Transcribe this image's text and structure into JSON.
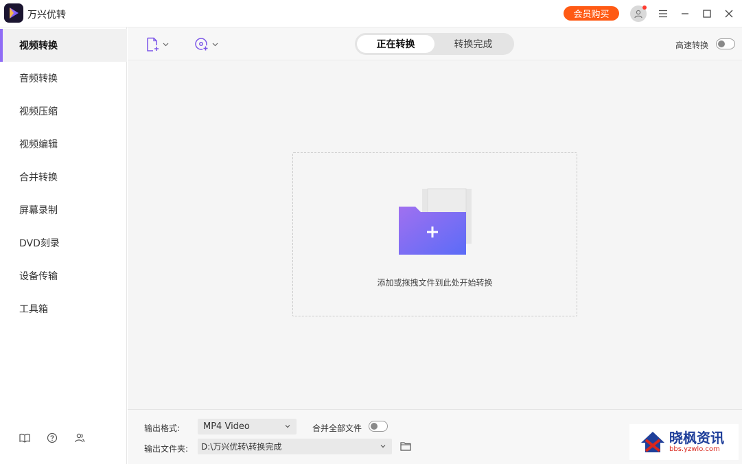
{
  "app": {
    "title": "万兴优转",
    "vip_label": "会员购买"
  },
  "sidebar": {
    "items": [
      {
        "label": "视频转换",
        "active": true
      },
      {
        "label": "音频转换"
      },
      {
        "label": "视频压缩"
      },
      {
        "label": "视频编辑"
      },
      {
        "label": "合并转换"
      },
      {
        "label": "屏幕录制"
      },
      {
        "label": "DVD刻录"
      },
      {
        "label": "设备传输"
      },
      {
        "label": "工具箱"
      }
    ],
    "bottom_icons": [
      "book-icon",
      "help-icon",
      "users-icon"
    ]
  },
  "toolbar": {
    "tabs": [
      {
        "label": "正在转换",
        "active": true
      },
      {
        "label": "转换完成"
      }
    ],
    "speed_label": "高速转换",
    "speed_on": false,
    "add_file_icon": "file-add-icon",
    "add_dvd_icon": "dvd-add-icon"
  },
  "dropzone": {
    "text": "添加或拖拽文件到此处开始转换"
  },
  "output": {
    "format_label": "输出格式:",
    "format_value": "MP4 Video",
    "merge_label": "合并全部文件",
    "merge_on": false,
    "folder_label": "输出文件夹:",
    "folder_value": "D:\\万兴优转\\转换完成"
  },
  "watermark": {
    "main": "晓枫资讯",
    "sub": "bbs.yzwlo.com"
  },
  "colors": {
    "accent": "#8f6cf5",
    "vip": "#ff5a14",
    "folder_gradient_start": "#a070f0",
    "folder_gradient_end": "#5b6cf7"
  }
}
